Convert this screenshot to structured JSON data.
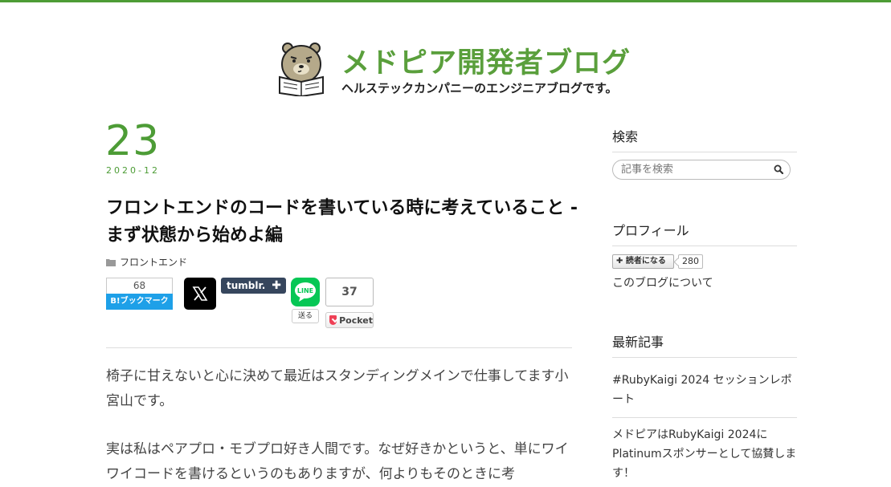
{
  "colors": {
    "accent": "#4d9c36",
    "title": "#5a9f3c",
    "hatena": "#1ea0e8",
    "tumblr": "#36465d",
    "line": "#06c755",
    "pocket": "#ef4056"
  },
  "header": {
    "title": "メドピア開発者ブログ",
    "description": "ヘルステックカンパニーのエンジニアブログです。"
  },
  "entry": {
    "date_day": "23",
    "date_ym": "2020-12",
    "title": "フロントエンドのコードを書いている時に考えていること - まず状態から始めよ編",
    "category": "フロントエンド",
    "paragraphs": [
      "椅子に甘えないと心に決めて最近はスタンディングメインで仕事してます小宮山です。",
      "実は私はペアプロ・モブプロ好き人間です。なぜ好きかというと、単にワイワイコードを書けるというのもありますが、何よりもそのときに考"
    ]
  },
  "share": {
    "hatena_count": "68",
    "hatena_label": "B!ブックマーク",
    "tumblr_label": "tumblr.",
    "line_label": "LINE",
    "line_send": "送る",
    "pocket_count": "37",
    "pocket_label": "Pocket"
  },
  "sidebar": {
    "search_heading": "検索",
    "search_placeholder": "記事を検索",
    "profile_heading": "プロフィール",
    "reader_button": "読者になる",
    "reader_count": "280",
    "about_link": "このブログについて",
    "recent_heading": "最新記事",
    "recent": [
      "#RubyKaigi 2024 セッションレポート",
      "メドピアはRubyKaigi 2024にPlatinumスポンサーとして協賛します！"
    ]
  }
}
